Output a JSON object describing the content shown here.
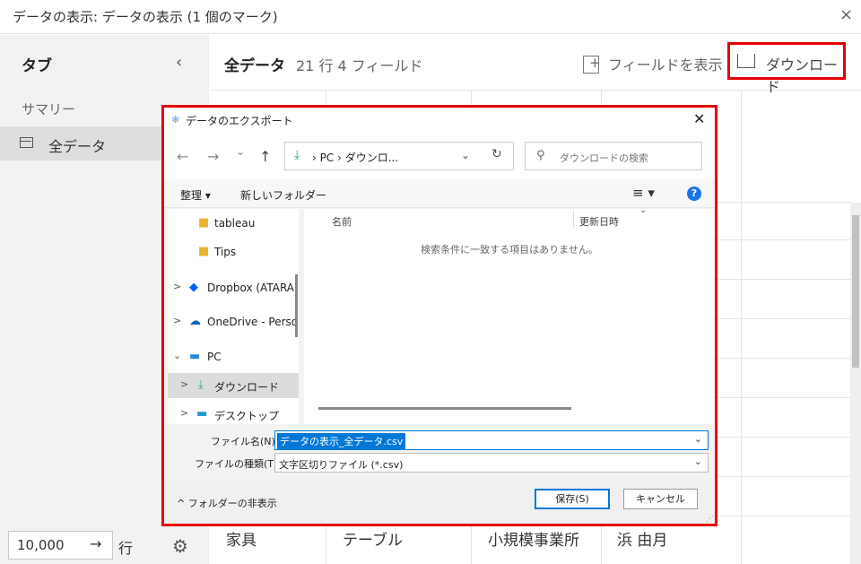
{
  "window": {
    "title": "データの表示: データの表示 (1 個のマーク)",
    "close": "×"
  },
  "sidebar": {
    "heading": "タブ",
    "collapse_glyph": "‹",
    "summary": "サマリー",
    "all_data": "全データ",
    "rows_value": "10,000",
    "rows_arrow": "→",
    "rows_label": "行",
    "gear_glyph": "⚙"
  },
  "main": {
    "title": "全データ",
    "count": "21 行 4 フィールド",
    "show_fields": "フィールドを表示",
    "download": "ダウンロード"
  },
  "table": {
    "visible_row": [
      "家具",
      "テーブル",
      "小規模事業所",
      "浜 由月"
    ]
  },
  "dialog": {
    "title": "データのエクスポート",
    "close": "✕",
    "nav": {
      "back": "←",
      "forward": "→",
      "recent": "⌄",
      "up": "↑"
    },
    "address": {
      "pc": "PC",
      "sep": "›",
      "folder": "ダウンロ...",
      "dropdown": "⌄",
      "refresh": "↻"
    },
    "search_placeholder": "ダウンロードの検索",
    "toolbar": {
      "organize": "整理 ▾",
      "new_folder": "新しいフォルダー",
      "view": "≡ ▾",
      "help": "?"
    },
    "tree": [
      {
        "label": "tableau",
        "expander": "",
        "icon": "folder-icon"
      },
      {
        "label": "Tips",
        "expander": "",
        "icon": "folder-icon"
      },
      {
        "label": "Dropbox (ATARA",
        "expander": ">",
        "icon": "dropbox-icon"
      },
      {
        "label": "OneDrive - Perso",
        "expander": ">",
        "icon": "onedrive-icon"
      },
      {
        "label": "PC",
        "expander": "⌄",
        "icon": "pc-icon"
      },
      {
        "label": "ダウンロード",
        "expander": ">",
        "icon": "download-icon"
      },
      {
        "label": "デスクトップ",
        "expander": ">",
        "icon": "desktop-icon"
      }
    ],
    "columns": {
      "name": "名前",
      "date": "更新日時"
    },
    "empty_message": "検索条件に一致する項目はありません。",
    "filename_label": "ファイル名(N):",
    "filename_value": "データの表示_全データ.csv",
    "filetype_label": "ファイルの種類(T):",
    "filetype_value": "文字区切りファイル (*.csv)",
    "hide_folders": "^ フォルダーの非表示",
    "save": "保存(S)",
    "cancel": "キャンセル"
  },
  "colors": {
    "highlight_border": "#e60000",
    "accent": "#0078d7"
  }
}
